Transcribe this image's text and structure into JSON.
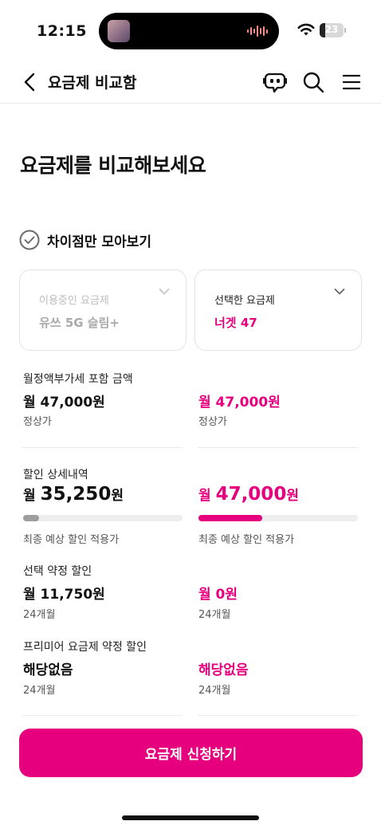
{
  "status": {
    "time": "12:15",
    "battery_level": "23",
    "battery_fraction": 0.23
  },
  "nav": {
    "title": "요금제 비교함"
  },
  "heading": "요금제를 비교해보세요",
  "diff_toggle": {
    "label": "차이점만 모아보기"
  },
  "plans": {
    "current": {
      "caption": "이용중인 요금제",
      "name": "유쓰 5G 슬림+"
    },
    "selected": {
      "caption": "선택한 요금제",
      "name": "너겟 47"
    }
  },
  "monthly": {
    "label": "월정액",
    "sub": "부가세 포함 금액",
    "current": {
      "amount": "월 47,000원",
      "note": "정상가"
    },
    "selected": {
      "amount": "월 47,000원",
      "note": "정상가"
    }
  },
  "discount": {
    "label": "할인 상세내역",
    "current": {
      "prefix": "월",
      "amount": "35,250",
      "unit": "원",
      "note": "최종 예상 할인 적용가",
      "bar_fraction": 0.1
    },
    "selected": {
      "prefix": "월",
      "amount": "47,000",
      "unit": "원",
      "note": "최종 예상 할인 적용가",
      "bar_fraction": 0.4
    }
  },
  "contract": {
    "label": "선택 약정 할인",
    "current": {
      "amount": "월 11,750원",
      "note": "24개월"
    },
    "selected": {
      "amount": "월 0원",
      "note": "24개월"
    }
  },
  "premium": {
    "label": "프리미어 요금제 약정 할인",
    "current": {
      "amount": "해당없음",
      "note": "24개월"
    },
    "selected": {
      "amount": "해당없음",
      "note": "24개월"
    }
  },
  "cta": {
    "label": "요금제 신청하기"
  },
  "colors": {
    "accent": "#e6007e",
    "bar_track": "#eeeeee",
    "bar_current": "#9e9e9e"
  }
}
